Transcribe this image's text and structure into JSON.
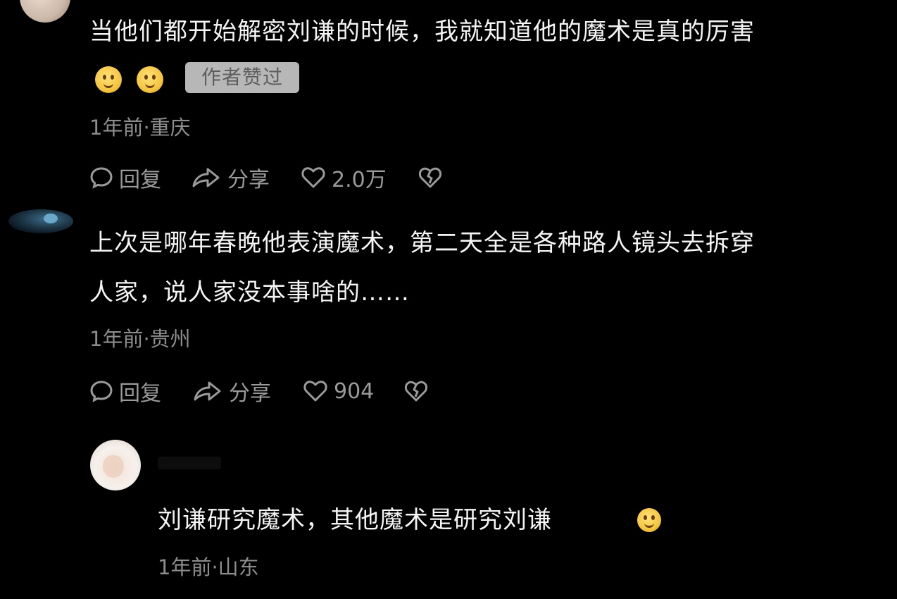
{
  "comments": [
    {
      "text": "当他们都开始解密刘谦的时候，我就知道他的魔术是真的厉害",
      "badge": "作者赞过",
      "meta": "1年前·重庆",
      "actions": {
        "reply": "回复",
        "share": "分享",
        "likes": "2.0万"
      }
    },
    {
      "text_line1": "上次是哪年春晚他表演魔术，第二天全是各种路人镜头去拆穿",
      "text_line2": "人家，说人家没本事啥的……",
      "meta": "1年前·贵州",
      "actions": {
        "reply": "回复",
        "share": "分享",
        "likes": "904"
      }
    },
    {
      "text": "刘谦研究魔术，其他魔术是研究刘谦",
      "meta": "1年前·山东"
    }
  ],
  "colors": {
    "background": "#000000",
    "text": "#f4f4f4",
    "meta": "#8d8d8d",
    "badge_bg": "#b7b7b7",
    "emoji": "#f5c542"
  }
}
